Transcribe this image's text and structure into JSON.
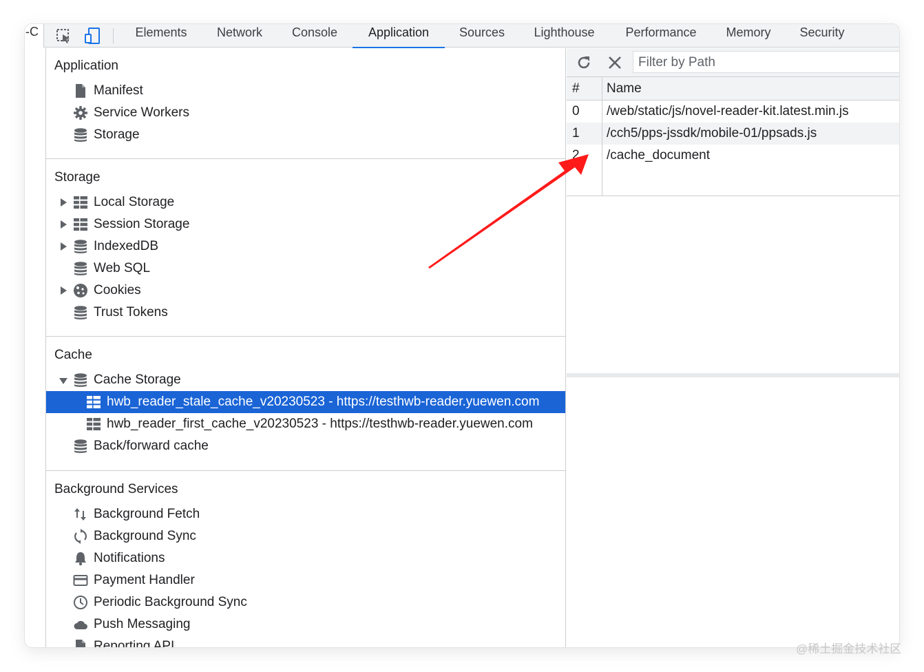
{
  "toolbar": {
    "stub_text": "-C",
    "tabs": [
      {
        "label": "Elements"
      },
      {
        "label": "Network"
      },
      {
        "label": "Console"
      },
      {
        "label": "Application"
      },
      {
        "label": "Sources"
      },
      {
        "label": "Lighthouse"
      },
      {
        "label": "Performance"
      },
      {
        "label": "Memory"
      },
      {
        "label": "Security"
      }
    ],
    "active_tab": "Application"
  },
  "sidebar": {
    "application": {
      "title": "Application",
      "items": [
        {
          "label": "Manifest",
          "icon": "file-icon"
        },
        {
          "label": "Service Workers",
          "icon": "gear-icon"
        },
        {
          "label": "Storage",
          "icon": "database-icon"
        }
      ]
    },
    "storage": {
      "title": "Storage",
      "items": [
        {
          "label": "Local Storage",
          "icon": "table-icon"
        },
        {
          "label": "Session Storage",
          "icon": "table-icon"
        },
        {
          "label": "IndexedDB",
          "icon": "database-icon"
        },
        {
          "label": "Web SQL",
          "icon": "database-icon"
        },
        {
          "label": "Cookies",
          "icon": "cookie-icon"
        },
        {
          "label": "Trust Tokens",
          "icon": "database-icon"
        }
      ]
    },
    "cache": {
      "title": "Cache",
      "items": [
        {
          "label": "Cache Storage",
          "icon": "database-icon"
        },
        {
          "label": "hwb_reader_stale_cache_v20230523 - https://testhwb-reader.yuewen.com",
          "icon": "table-icon"
        },
        {
          "label": "hwb_reader_first_cache_v20230523 - https://testhwb-reader.yuewen.com",
          "icon": "table-icon"
        },
        {
          "label": "Back/forward cache",
          "icon": "database-icon"
        }
      ]
    },
    "background": {
      "title": "Background Services",
      "items": [
        {
          "label": "Background Fetch",
          "icon": "up-down-arrows-icon"
        },
        {
          "label": "Background Sync",
          "icon": "sync-icon"
        },
        {
          "label": "Notifications",
          "icon": "bell-icon"
        },
        {
          "label": "Payment Handler",
          "icon": "credit-card-icon"
        },
        {
          "label": "Periodic Background Sync",
          "icon": "clock-icon"
        },
        {
          "label": "Push Messaging",
          "icon": "cloud-icon"
        },
        {
          "label": "Reporting API",
          "icon": "file-icon"
        }
      ]
    }
  },
  "cache_view": {
    "filter_placeholder": "Filter by Path",
    "columns": [
      "#",
      "Name"
    ],
    "rows": [
      {
        "index": "0",
        "name": "/web/static/js/novel-reader-kit.latest.min.js"
      },
      {
        "index": "1",
        "name": "/cch5/pps-jssdk/mobile-01/ppsads.js"
      },
      {
        "index": "2",
        "name": "/cache_document"
      }
    ]
  },
  "colors": {
    "selection": "#1a64d6",
    "active_tab_underline": "#1a73e8",
    "annotation_arrow": "#ff1a1a"
  },
  "watermark": "@稀土掘金技术社区"
}
